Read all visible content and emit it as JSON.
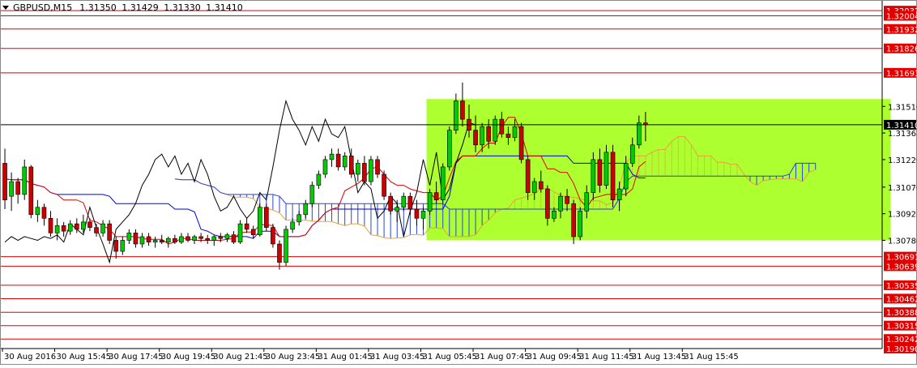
{
  "header": {
    "symbol": "GBPUSD,M15",
    "open": "1.31350",
    "high": "1.31429",
    "low": "1.31330",
    "close": "1.31410"
  },
  "colors": {
    "bull": "#00cc00",
    "bear": "#cc0000",
    "zone": "#adff2f",
    "level_line": "#e00000",
    "level_label_bg": "#e00000",
    "price_line": "#000000",
    "tenkan": "#e00000",
    "kijun": "#0000dd",
    "chikou": "#000000",
    "cloud_up": "#e8a23c",
    "cloud_down": "#2a44d8",
    "axis": "#000000"
  },
  "chart_data": {
    "type": "candlestick",
    "instrument": "GBPUSD",
    "timeframe": "M15",
    "ylim": [
      1.3019,
      1.3209
    ],
    "price_axis_labels": [
      "1.31510",
      "1.31365",
      "1.31220",
      "1.31070",
      "1.30925",
      "1.30780"
    ],
    "current_price": "1.31410",
    "levels": [
      {
        "label": "1.32032",
        "value": 1.32032
      },
      {
        "label": "1.32004",
        "value": 1.32004
      },
      {
        "label": "1.31932",
        "value": 1.31932
      },
      {
        "label": "1.31826",
        "value": 1.31826
      },
      {
        "label": "1.31693",
        "value": 1.31693
      },
      {
        "label": "1.30691",
        "value": 1.30691
      },
      {
        "label": "1.30639",
        "value": 1.30639
      },
      {
        "label": "1.30535",
        "value": 1.30535
      },
      {
        "label": "1.30462",
        "value": 1.30462
      },
      {
        "label": "1.30388",
        "value": 1.30388
      },
      {
        "label": "1.30315",
        "value": 1.30315
      },
      {
        "label": "1.30242",
        "value": 1.30242
      },
      {
        "label": "1.30190",
        "value": 1.3019
      }
    ],
    "highlight_zone": {
      "price_top": 1.3155,
      "price_bottom": 1.3078,
      "start_bar": 65,
      "end_bar": 136
    },
    "time_labels": [
      {
        "bar": 0,
        "text": "30 Aug 2016"
      },
      {
        "bar": 8,
        "text": "30 Aug 15:45"
      },
      {
        "bar": 16,
        "text": "30 Aug 17:45"
      },
      {
        "bar": 24,
        "text": "30 Aug 19:45"
      },
      {
        "bar": 32,
        "text": "30 Aug 21:45"
      },
      {
        "bar": 40,
        "text": "30 Aug 23:45"
      },
      {
        "bar": 48,
        "text": "31 Aug 01:45"
      },
      {
        "bar": 56,
        "text": "31 Aug 03:45"
      },
      {
        "bar": 64,
        "text": "31 Aug 05:45"
      },
      {
        "bar": 72,
        "text": "31 Aug 07:45"
      },
      {
        "bar": 80,
        "text": "31 Aug 09:45"
      },
      {
        "bar": 88,
        "text": "31 Aug 11:45"
      },
      {
        "bar": 96,
        "text": "31 Aug 13:45"
      },
      {
        "bar": 104,
        "text": "31 Aug 15:45"
      }
    ],
    "candles": [
      [
        1.312,
        1.3128,
        1.3095,
        1.31
      ],
      [
        1.3102,
        1.3115,
        1.3094,
        1.311
      ],
      [
        1.311,
        1.3112,
        1.3098,
        1.3103
      ],
      [
        1.3103,
        1.3122,
        1.31,
        1.3118
      ],
      [
        1.3118,
        1.3119,
        1.309,
        1.3092
      ],
      [
        1.3092,
        1.31,
        1.3088,
        1.3096
      ],
      [
        1.3096,
        1.3098,
        1.3086,
        1.309
      ],
      [
        1.309,
        1.3094,
        1.308,
        1.3082
      ],
      [
        1.3082,
        1.309,
        1.3078,
        1.3086
      ],
      [
        1.3086,
        1.3088,
        1.308,
        1.3083
      ],
      [
        1.3083,
        1.3089,
        1.3081,
        1.3087
      ],
      [
        1.3087,
        1.309,
        1.3082,
        1.3084
      ],
      [
        1.3084,
        1.3092,
        1.3082,
        1.3088
      ],
      [
        1.3088,
        1.309,
        1.3083,
        1.3085
      ],
      [
        1.3085,
        1.3087,
        1.308,
        1.3082
      ],
      [
        1.3082,
        1.3089,
        1.308,
        1.3087
      ],
      [
        1.3087,
        1.3089,
        1.3076,
        1.3078
      ],
      [
        1.3078,
        1.308,
        1.3068,
        1.3072
      ],
      [
        1.3072,
        1.308,
        1.307,
        1.3078
      ],
      [
        1.3078,
        1.3084,
        1.3076,
        1.3082
      ],
      [
        1.3082,
        1.3084,
        1.3074,
        1.3076
      ],
      [
        1.3076,
        1.3082,
        1.3074,
        1.308
      ],
      [
        1.308,
        1.3082,
        1.3075,
        1.3077
      ],
      [
        1.3077,
        1.308,
        1.3074,
        1.3078
      ],
      [
        1.3078,
        1.3081,
        1.3076,
        1.3077
      ],
      [
        1.3077,
        1.308,
        1.3074,
        1.3079
      ],
      [
        1.3079,
        1.3081,
        1.3076,
        1.3077
      ],
      [
        1.3077,
        1.3082,
        1.3076,
        1.308
      ],
      [
        1.308,
        1.3082,
        1.3077,
        1.3078
      ],
      [
        1.3078,
        1.3081,
        1.3076,
        1.308
      ],
      [
        1.308,
        1.3082,
        1.3077,
        1.3079
      ],
      [
        1.3079,
        1.3081,
        1.3076,
        1.3078
      ],
      [
        1.3078,
        1.3081,
        1.3075,
        1.308
      ],
      [
        1.308,
        1.3082,
        1.3077,
        1.3079
      ],
      [
        1.3079,
        1.3082,
        1.3077,
        1.3081
      ],
      [
        1.3081,
        1.3083,
        1.3076,
        1.3077
      ],
      [
        1.3077,
        1.3089,
        1.3076,
        1.3087
      ],
      [
        1.3087,
        1.309,
        1.3082,
        1.3084
      ],
      [
        1.3084,
        1.3086,
        1.3079,
        1.3081
      ],
      [
        1.3081,
        1.3098,
        1.308,
        1.3096
      ],
      [
        1.3096,
        1.3098,
        1.3083,
        1.3085
      ],
      [
        1.3085,
        1.3087,
        1.3074,
        1.3076
      ],
      [
        1.3076,
        1.3078,
        1.3062,
        1.3066
      ],
      [
        1.3066,
        1.3086,
        1.3064,
        1.3084
      ],
      [
        1.3084,
        1.309,
        1.3082,
        1.3088
      ],
      [
        1.3088,
        1.3094,
        1.3086,
        1.3092
      ],
      [
        1.3092,
        1.31,
        1.309,
        1.3098
      ],
      [
        1.3098,
        1.311,
        1.3096,
        1.3108
      ],
      [
        1.3108,
        1.3116,
        1.3106,
        1.3114
      ],
      [
        1.3114,
        1.3124,
        1.3112,
        1.3122
      ],
      [
        1.3122,
        1.3128,
        1.3118,
        1.3125
      ],
      [
        1.3125,
        1.3128,
        1.3116,
        1.3118
      ],
      [
        1.3118,
        1.3126,
        1.3116,
        1.3124
      ],
      [
        1.3124,
        1.3128,
        1.3112,
        1.3114
      ],
      [
        1.3114,
        1.3122,
        1.311,
        1.312
      ],
      [
        1.312,
        1.3124,
        1.3108,
        1.311
      ],
      [
        1.311,
        1.3124,
        1.3108,
        1.3122
      ],
      [
        1.3122,
        1.3124,
        1.3112,
        1.3114
      ],
      [
        1.3114,
        1.3116,
        1.31,
        1.3102
      ],
      [
        1.3102,
        1.3104,
        1.3092,
        1.3094
      ],
      [
        1.3094,
        1.31,
        1.3088,
        1.3096
      ],
      [
        1.3096,
        1.3104,
        1.3094,
        1.3102
      ],
      [
        1.3102,
        1.3104,
        1.3092,
        1.3095
      ],
      [
        1.3095,
        1.31,
        1.3086,
        1.309
      ],
      [
        1.309,
        1.3096,
        1.3084,
        1.3094
      ],
      [
        1.3094,
        1.3106,
        1.3092,
        1.3104
      ],
      [
        1.3104,
        1.311,
        1.3098,
        1.31
      ],
      [
        1.31,
        1.312,
        1.3098,
        1.3118
      ],
      [
        1.3118,
        1.314,
        1.3116,
        1.3138
      ],
      [
        1.3138,
        1.3158,
        1.3136,
        1.3154
      ],
      [
        1.3154,
        1.3164,
        1.314,
        1.3144
      ],
      [
        1.3144,
        1.3152,
        1.3134,
        1.3138
      ],
      [
        1.3138,
        1.3146,
        1.3126,
        1.313
      ],
      [
        1.313,
        1.3142,
        1.3126,
        1.314
      ],
      [
        1.314,
        1.3144,
        1.3128,
        1.3132
      ],
      [
        1.3132,
        1.3146,
        1.313,
        1.3144
      ],
      [
        1.3144,
        1.3148,
        1.3134,
        1.3136
      ],
      [
        1.3136,
        1.314,
        1.313,
        1.3134
      ],
      [
        1.3134,
        1.3144,
        1.3132,
        1.314
      ],
      [
        1.314,
        1.3142,
        1.312,
        1.3122
      ],
      [
        1.3122,
        1.3124,
        1.31,
        1.3104
      ],
      [
        1.3104,
        1.3112,
        1.31,
        1.311
      ],
      [
        1.311,
        1.3116,
        1.3104,
        1.3106
      ],
      [
        1.3106,
        1.3108,
        1.3086,
        1.309
      ],
      [
        1.309,
        1.3096,
        1.3088,
        1.3094
      ],
      [
        1.3094,
        1.3104,
        1.309,
        1.3102
      ],
      [
        1.3102,
        1.3106,
        1.3094,
        1.3098
      ],
      [
        1.3098,
        1.31,
        1.3076,
        1.308
      ],
      [
        1.308,
        1.3096,
        1.3078,
        1.3094
      ],
      [
        1.3094,
        1.3108,
        1.309,
        1.3104
      ],
      [
        1.3104,
        1.3126,
        1.31,
        1.3122
      ],
      [
        1.3122,
        1.3128,
        1.3104,
        1.3108
      ],
      [
        1.3108,
        1.313,
        1.3106,
        1.3126
      ],
      [
        1.3126,
        1.313,
        1.3096,
        1.31
      ],
      [
        1.31,
        1.311,
        1.3094,
        1.3106
      ],
      [
        1.3106,
        1.3124,
        1.3102,
        1.312
      ],
      [
        1.312,
        1.3134,
        1.3118,
        1.313
      ],
      [
        1.313,
        1.3146,
        1.3128,
        1.3142
      ],
      [
        1.3142,
        1.3148,
        1.3132,
        1.3141
      ]
    ]
  }
}
